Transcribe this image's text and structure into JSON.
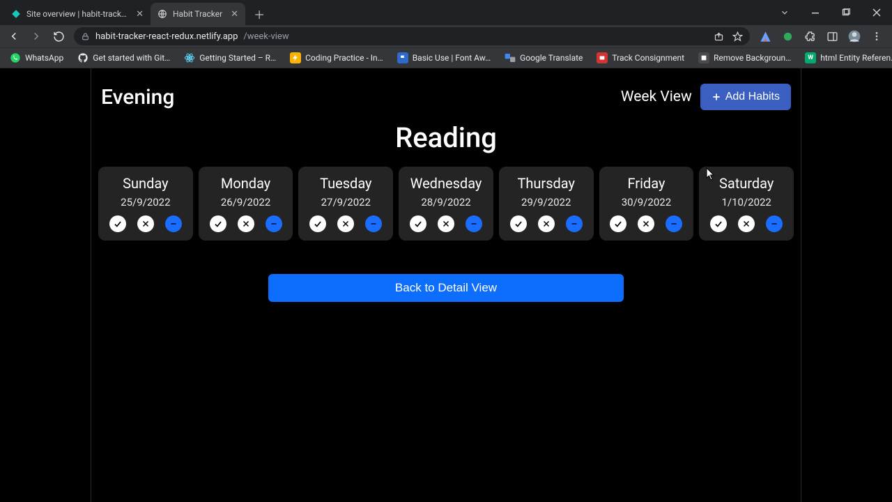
{
  "browser": {
    "tabs": [
      {
        "title": "Site overview | habit-tracker-reac",
        "active": false,
        "favicon": "netlify"
      },
      {
        "title": "Habit Tracker",
        "active": true,
        "favicon": "globe"
      }
    ],
    "url_host": "habit-tracker-react-redux.netlify.app",
    "url_path": "/week-view"
  },
  "bookmarks": [
    {
      "label": "WhatsApp",
      "icon": "whatsapp"
    },
    {
      "label": "Get started with Git…",
      "icon": "github"
    },
    {
      "label": "Getting Started – R…",
      "icon": "react"
    },
    {
      "label": "Coding Practice - In…",
      "icon": "bolt"
    },
    {
      "label": "Basic Use | Font Aw…",
      "icon": "flag"
    },
    {
      "label": "Google Translate",
      "icon": "translate"
    },
    {
      "label": "Track Consignment",
      "icon": "post"
    },
    {
      "label": "Remove Backgroun…",
      "icon": "removebg"
    },
    {
      "label": "html Entity Referen…",
      "icon": "w3"
    }
  ],
  "page": {
    "section_title": "Evening",
    "week_view_link": "Week View",
    "add_button": "Add Habits",
    "habit_title": "Reading",
    "days": [
      {
        "dow": "Sunday",
        "date": "25/9/2022"
      },
      {
        "dow": "Monday",
        "date": "26/9/2022"
      },
      {
        "dow": "Tuesday",
        "date": "27/9/2022"
      },
      {
        "dow": "Wednesday",
        "date": "28/9/2022"
      },
      {
        "dow": "Thursday",
        "date": "29/9/2022"
      },
      {
        "dow": "Friday",
        "date": "30/9/2022"
      },
      {
        "dow": "Saturday",
        "date": "1/10/2022"
      }
    ],
    "back_button": "Back to Detail View"
  }
}
